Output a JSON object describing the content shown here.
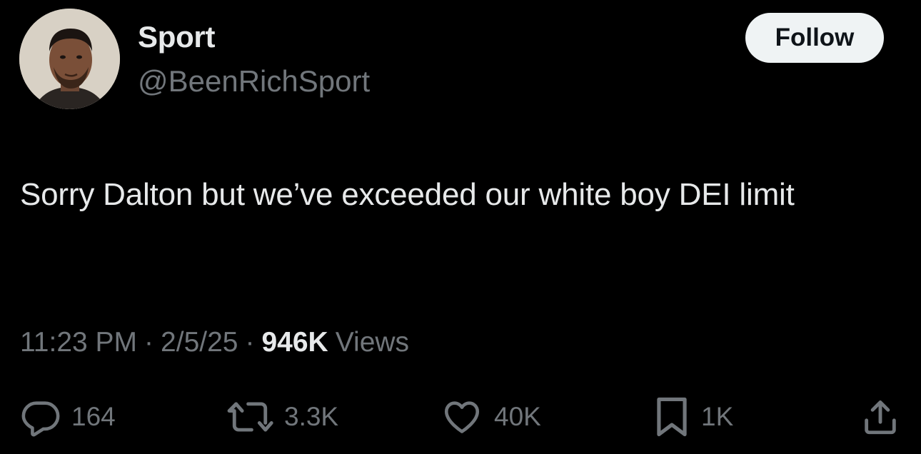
{
  "user": {
    "display_name": "Sport",
    "handle": "@BeenRichSport"
  },
  "follow_button": {
    "label": "Follow"
  },
  "tweet": {
    "text": "Sorry Dalton but we’ve exceeded our white boy DEI limit",
    "time": "11:23 PM",
    "separator": "·",
    "date": "2/5/25",
    "views_count": "946K",
    "views_label": "Views"
  },
  "actions": {
    "replies": "164",
    "reposts": "3.3K",
    "likes": "40K",
    "bookmarks": "1K"
  },
  "icons": {
    "reply": "reply-icon",
    "repost": "repost-icon",
    "like": "heart-icon",
    "bookmark": "bookmark-icon",
    "share": "share-icon"
  },
  "colors": {
    "background": "#000000",
    "primary_text": "#e7e9ea",
    "secondary_text": "#71767b",
    "follow_button_bg": "#eff3f4",
    "follow_button_text": "#0f1419"
  }
}
